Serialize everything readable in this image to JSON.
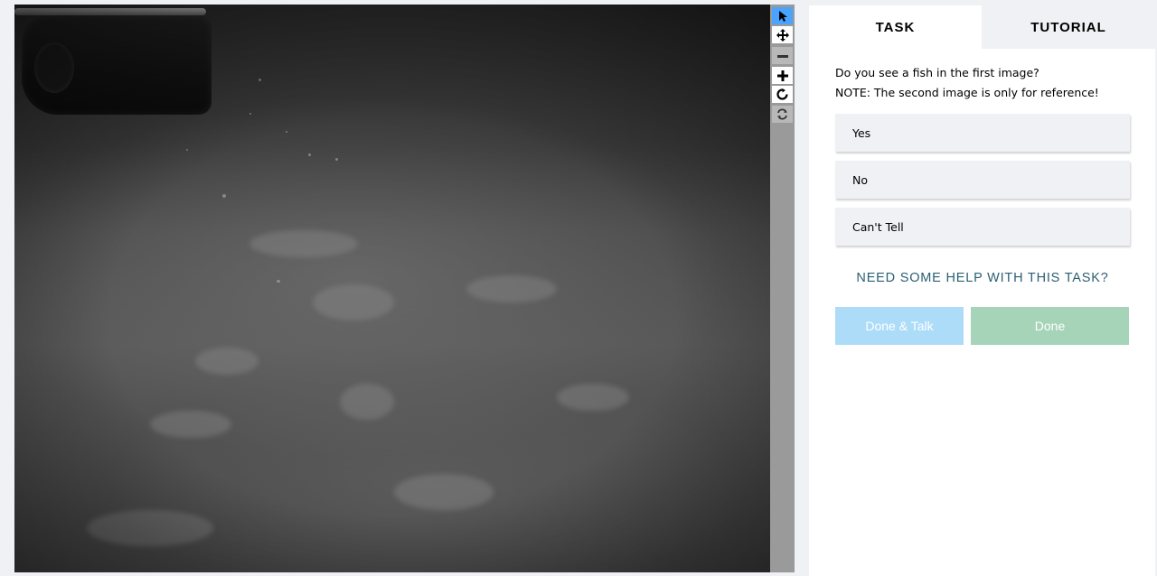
{
  "tabs": {
    "task": "TASK",
    "tutorial": "TUTORIAL"
  },
  "question": {
    "line1": "Do you see a fish in the first image?",
    "line2": "NOTE: The second image is only for reference!"
  },
  "answers": [
    {
      "label": "Yes"
    },
    {
      "label": "No"
    },
    {
      "label": "Can't Tell"
    }
  ],
  "help_link": "NEED SOME HELP WITH THIS TASK?",
  "buttons": {
    "done_talk": "Done & Talk",
    "done": "Done"
  },
  "toolbar": {
    "tools": [
      {
        "icon": "pointer-icon",
        "state": "active"
      },
      {
        "icon": "move-icon",
        "state": "normal"
      },
      {
        "icon": "zoom-out-icon",
        "state": "disabled"
      },
      {
        "icon": "zoom-in-icon",
        "state": "normal"
      },
      {
        "icon": "rotate-icon",
        "state": "normal"
      },
      {
        "icon": "reset-icon",
        "state": "disabled"
      }
    ]
  },
  "colors": {
    "accent_blue": "#4aa3ff",
    "done_talk_bg": "#addcf8",
    "done_bg": "#a6d4b8",
    "help_text": "#2b5f73",
    "panel_bg": "#eff1f4"
  }
}
